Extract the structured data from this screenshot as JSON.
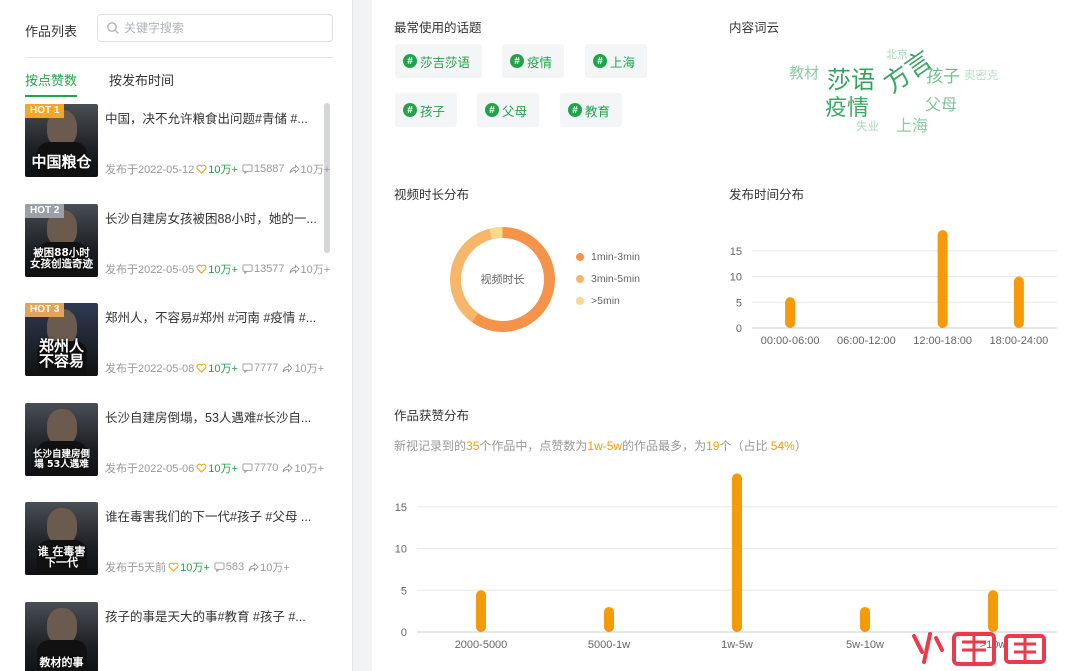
{
  "left": {
    "title": "作品列表",
    "search_placeholder": "关键字搜索",
    "tabs": [
      "按点赞数",
      "按发布时间"
    ],
    "items": [
      {
        "hot": "HOT 1",
        "cover": "中国粮仓",
        "title": "中国，决不允许粮食出问题#青储 #...",
        "published": "发布于2022-05-12",
        "likes": "10万+",
        "comments": "15887",
        "shares": "10万+"
      },
      {
        "hot": "HOT 2",
        "cover": "被困88小时 女孩创造奇迹",
        "title": "长沙自建房女孩被困88小时，她的一...",
        "published": "发布于2022-05-05",
        "likes": "10万+",
        "comments": "13577",
        "shares": "10万+"
      },
      {
        "hot": "HOT 3",
        "cover": "郑州人 不容易",
        "title": "郑州人，不容易#郑州 #河南 #疫情 #...",
        "published": "发布于2022-05-08",
        "likes": "10万+",
        "comments": "7777",
        "shares": "10万+"
      },
      {
        "hot": "",
        "cover": "长沙自建房倒塌 53人遇难",
        "title": "长沙自建房倒塌，53人遇难#长沙自...",
        "published": "发布于2022-05-06",
        "likes": "10万+",
        "comments": "7770",
        "shares": "10万+"
      },
      {
        "hot": "",
        "cover": "谁 在毒害 下一代",
        "title": "谁在毒害我们的下一代#孩子 #父母 ...",
        "published": "发布于5天前",
        "likes": "10万+",
        "comments": "583",
        "shares": "10万+"
      },
      {
        "hot": "",
        "cover": "教材的事",
        "title": "孩子的事是天大的事#教育 #孩子 #...",
        "published": "",
        "likes": "",
        "comments": "",
        "shares": ""
      }
    ]
  },
  "topics": {
    "title": "最常使用的话题",
    "items": [
      "莎吉莎语",
      "疫情",
      "上海",
      "孩子",
      "父母",
      "教育"
    ]
  },
  "wordcloud": {
    "title": "内容词云",
    "words": [
      "莎语",
      "疫情",
      "方言",
      "孩子",
      "父母",
      "上海",
      "教材",
      "北京",
      "失业",
      "奥密克"
    ]
  },
  "duration": {
    "title": "视频时长分布",
    "center_label": "视频时长",
    "legend": [
      {
        "label": "1min-3min",
        "color": "#f5934a",
        "value": 60
      },
      {
        "label": "3min-5min",
        "color": "#f7b76a",
        "value": 36
      },
      {
        "label": ">5min",
        "color": "#fad98c",
        "value": 4
      }
    ]
  },
  "colors": {
    "accent": "#22a34a",
    "bar": "#f59a0b"
  },
  "chart_data": [
    {
      "type": "bar",
      "title": "发布时间分布",
      "categories": [
        "00:00-06:00",
        "06:00-12:00",
        "12:00-18:00",
        "18:00-24:00"
      ],
      "values": [
        6,
        0,
        19,
        10
      ],
      "ylim": [
        0,
        20
      ],
      "yticks": [
        0,
        5,
        10,
        15
      ],
      "grid": true
    },
    {
      "type": "bar",
      "title": "作品获赞分布",
      "categories": [
        "2000-5000",
        "5000-1w",
        "1w-5w",
        "5w-10w",
        ">10w"
      ],
      "values": [
        5,
        3,
        19,
        3,
        5
      ],
      "ylim": [
        0,
        20
      ],
      "yticks": [
        0,
        5,
        10,
        15
      ],
      "grid": true
    }
  ],
  "likes_summary": {
    "prefix": "新视记录到的",
    "total": "35",
    "mid1": "个作品中，点赞数为",
    "range": "1w-5w",
    "mid2": "的作品最多，为",
    "count": "19",
    "mid3": "个（占比 ",
    "pct": "54%",
    "suffix": "）"
  }
}
